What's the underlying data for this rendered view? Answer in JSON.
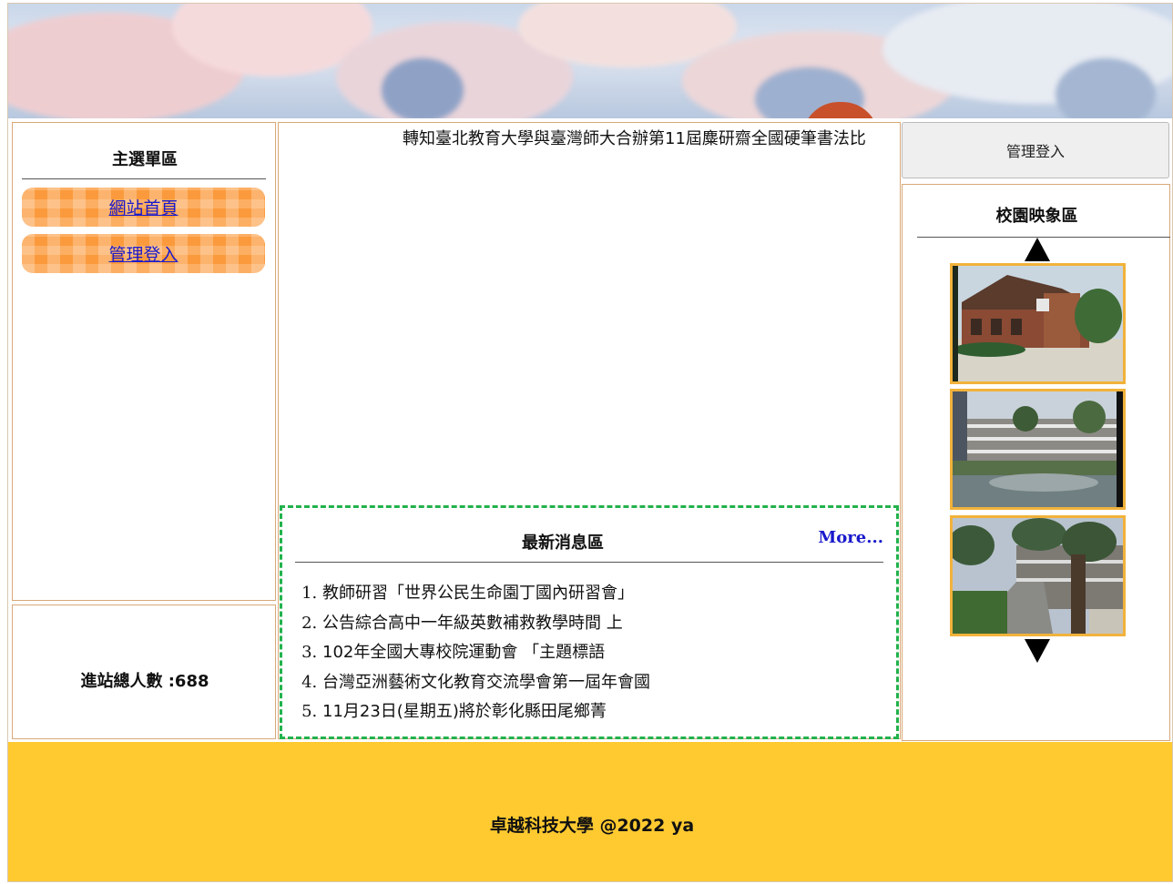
{
  "banner": {
    "icon": "campus-banner-sky"
  },
  "left_menu": {
    "title": "主選單區",
    "items": [
      {
        "label": "網站首頁"
      },
      {
        "label": "管理登入"
      }
    ],
    "button_color": "#fb9a3c",
    "link_color": "#1a1acc"
  },
  "counter": {
    "label": "進站總人數 :688"
  },
  "marquee": {
    "text": "轉知臺北教育大學與臺灣師大合辦第11屆麋研齋全國硬筆書法比"
  },
  "news": {
    "title": "最新消息區",
    "more_label": "More...",
    "border_color": "#22b24c",
    "items": [
      "教師研習「世界公民生命園丁國內研習會」",
      "公告綜合高中一年級英數補救教學時間 上",
      "102年全國大專校院運動會 「主題標語",
      "台灣亞洲藝術文化教育交流學會第一屆年會國",
      "11月23日(星期五)將於彰化縣田尾鄉菁"
    ]
  },
  "admin_button": {
    "label": "管理登入"
  },
  "campus": {
    "title": "校園映象區",
    "frame_color": "#f1b23b",
    "photos": [
      {
        "icon": "campus-photo-brick-building"
      },
      {
        "icon": "campus-photo-pond-building"
      },
      {
        "icon": "campus-photo-road-palms"
      }
    ],
    "up_icon": "triangle-up-icon",
    "down_icon": "triangle-down-icon"
  },
  "footer": {
    "text": "卓越科技大學 @2022 ya",
    "background": "#ffca30"
  }
}
